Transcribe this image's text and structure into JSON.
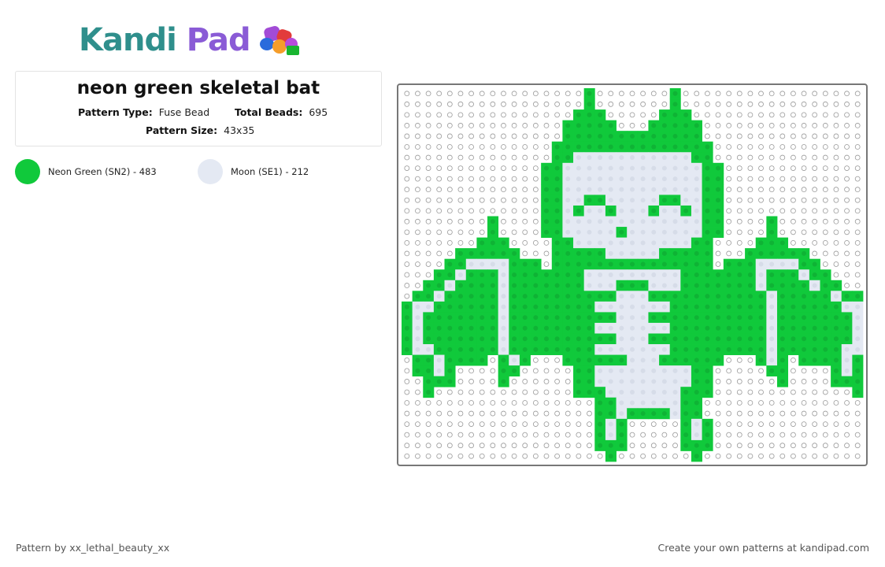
{
  "brand": {
    "logo_part1": "Kandi",
    "logo_part2": "Pad"
  },
  "pattern": {
    "title": "neon green skeletal bat",
    "type_label": "Pattern Type:",
    "type_value": "Fuse Bead",
    "beads_label": "Total Beads:",
    "beads_value": "695",
    "size_label": "Pattern Size:",
    "size_value": "43x35"
  },
  "palette": [
    {
      "label": "Neon Green (SN2) - 483",
      "color": "#10c93b"
    },
    {
      "label": "Moon (SE1) - 212",
      "color": "#e4e9f3"
    }
  ],
  "grid": {
    "cols": 43,
    "rows": 35,
    "rows_data": [
      "                 G       G                 ",
      "                 G       G                 ",
      "                GGG     GGG                ",
      "               GGGGG   GGGGG               ",
      "               GGGGGGGGGGGGG               ",
      "              GGGGGGGGGGGGGGG              ",
      "              GGMMMMMMMMMMMGG              ",
      "             GGMMMMMMMMMMMMMGG             ",
      "             GGMMMMMMMMMMMMMGG             ",
      "             GGMMMMMMMMMMMMMGG             ",
      "             GGMMGGMMMMMGGMMGG             ",
      "             GGMGMMGMMMGMMGMGG             ",
      "        G    GGMMMMMMMMMMMMMGG    G        ",
      "        G    GGMMMMMGMMMMMMMGG    G        ",
      "       GGG    GGMMMMMMMMMMMGG    GGG       ",
      "     GGGGGG   GGGGGMMMMMGGGGG   GGGGGG     ",
      "    GGMMMMGGG GGGGGGGGGGGGGGG GGGMMMMGG    ",
      "   GGMGGGMGGGGGGGMMMMMMMMMGGGGGGGMGGGMGG   ",
      "  GGMGGGGMGGGGGGGMMMGGGMMMGGGGGGGMGGGGMGG  ",
      " GGMGGGGGMGGGGGGGGGGMMMGGGGGGGGGGGMGGGGGMGG ",
      "GMMGGGGGGMGGGGGGGGMMMMMMMGGGGGGGGGMGGGGGGMMG",
      "GMGGGGGGGMGGGGGGGGGGMMMGGGGGGGGGGGMGGGGGGGMG",
      "GMGGGGGGGMGGGGGGGGMMMMMMMGGGGGGGGGMGGGGGGGMG",
      "GMGGGGGGGMGGGGGGGGGGMMMGGGGGGGGGGGMGGGGGGGMG",
      "GMMGGGGGGMGGGGGGGGMMMMMMMGGGGGGGGGMGGGGGGMMG",
      " GGMGGGG GMG   GGGGGGMMMGGGGGG   GMG GGGGMGG ",
      " GGMG    GG     GGMMMMMMMMMGG     GG    GMGG ",
      "  GGG    G      GGMMMMMMMMMGG      G    GGG ",
      "  G             GGGMMMMMMMGGG             G",
      "                  GGMMMMMMGG               ",
      "                  GGMGGGGMGG               ",
      "                  GMG     GMG              ",
      "                  GMG     GMG              ",
      "                  GGG     GGG              ",
      "                   G       G               "
    ]
  },
  "footer": {
    "credit": "Pattern by xx_lethal_beauty_xx",
    "cta": "Create your own patterns at kandipad.com"
  }
}
